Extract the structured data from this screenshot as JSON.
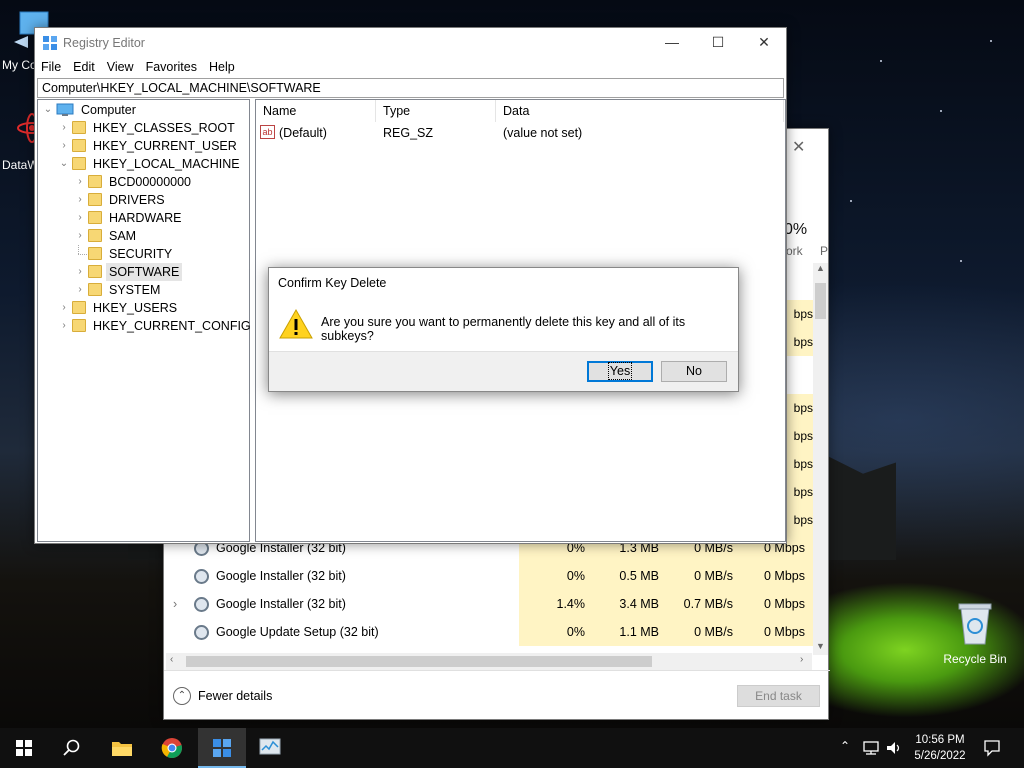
{
  "desktop": {
    "icons": [
      {
        "label": "My Co"
      },
      {
        "label": "DataW"
      },
      {
        "label": "Recycle Bin"
      }
    ]
  },
  "task_manager": {
    "partial_percent": "0%",
    "partial_headers": [
      "ork",
      "P"
    ],
    "rows": [
      {
        "name": "Google Installer (32 bit)",
        "cpu": "0%",
        "memory": "1.3 MB",
        "disk": "0 MB/s",
        "network": "0 Mbps",
        "expandable": false
      },
      {
        "name": "Google Installer (32 bit)",
        "cpu": "0%",
        "memory": "0.5 MB",
        "disk": "0 MB/s",
        "network": "0 Mbps",
        "expandable": false
      },
      {
        "name": "Google Installer (32 bit)",
        "cpu": "1.4%",
        "memory": "3.4 MB",
        "disk": "0.7 MB/s",
        "network": "0 Mbps",
        "expandable": true
      },
      {
        "name": "Google Update Setup (32 bit)",
        "cpu": "0%",
        "memory": "1.1 MB",
        "disk": "0 MB/s",
        "network": "0 Mbps",
        "expandable": false
      }
    ],
    "partial_network_column": [
      "bps",
      "bps",
      "bps",
      "bps",
      "bps",
      "bps",
      "bps",
      "bps"
    ],
    "fewer_details": "Fewer details",
    "end_task": "End task"
  },
  "registry_editor": {
    "title": "Registry Editor",
    "menu": [
      "File",
      "Edit",
      "View",
      "Favorites",
      "Help"
    ],
    "address": "Computer\\HKEY_LOCAL_MACHINE\\SOFTWARE",
    "tree": [
      {
        "label": "Computer",
        "level": 0,
        "chev": "⌄"
      },
      {
        "label": "HKEY_CLASSES_ROOT",
        "level": 1,
        "chev": "›"
      },
      {
        "label": "HKEY_CURRENT_USER",
        "level": 1,
        "chev": "›"
      },
      {
        "label": "HKEY_LOCAL_MACHINE",
        "level": 1,
        "chev": "⌄"
      },
      {
        "label": "BCD00000000",
        "level": 2,
        "chev": "›"
      },
      {
        "label": "DRIVERS",
        "level": 2,
        "chev": "›"
      },
      {
        "label": "HARDWARE",
        "level": 2,
        "chev": "›"
      },
      {
        "label": "SAM",
        "level": 2,
        "chev": "›"
      },
      {
        "label": "SECURITY",
        "level": 2,
        "chev": ""
      },
      {
        "label": "SOFTWARE",
        "level": 2,
        "chev": "›",
        "selected": true
      },
      {
        "label": "SYSTEM",
        "level": 2,
        "chev": "›"
      },
      {
        "label": "HKEY_USERS",
        "level": 1,
        "chev": "›"
      },
      {
        "label": "HKEY_CURRENT_CONFIG",
        "level": 1,
        "chev": "›"
      }
    ],
    "columns": {
      "name": "Name",
      "type": "Type",
      "data": "Data"
    },
    "values": [
      {
        "name": "(Default)",
        "type": "REG_SZ",
        "data": "(value not set)"
      }
    ]
  },
  "dialog": {
    "title": "Confirm Key Delete",
    "message": "Are you sure you want to permanently delete this key and all of its subkeys?",
    "yes": "Yes",
    "no": "No"
  },
  "taskbar": {
    "time": "10:56 PM",
    "date": "5/26/2022"
  }
}
